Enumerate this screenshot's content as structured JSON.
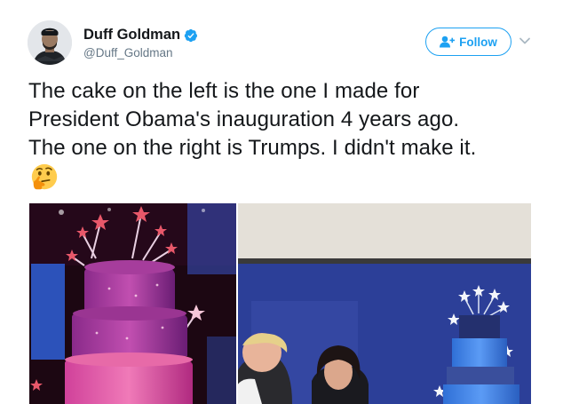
{
  "tweet": {
    "author": {
      "display_name": "Duff Goldman",
      "handle": "@Duff_Goldman",
      "verified": true,
      "avatar_icon": "avatar-photo"
    },
    "follow_label": "Follow",
    "menu_icon": "chevron-down-icon",
    "text_lines": [
      "The cake on the left is the one I made for",
      "President Obama's inauguration 4 years ago.",
      "The one on the right is Trumps. I didn't make it."
    ],
    "emoji": "thinking-face-emoji",
    "media": {
      "left_image": "obama-inauguration-cake-photo",
      "right_image": "trump-inauguration-cake-photo"
    }
  },
  "colors": {
    "accent": "#1da1f2",
    "text": "#14171a",
    "muted": "#657786"
  }
}
